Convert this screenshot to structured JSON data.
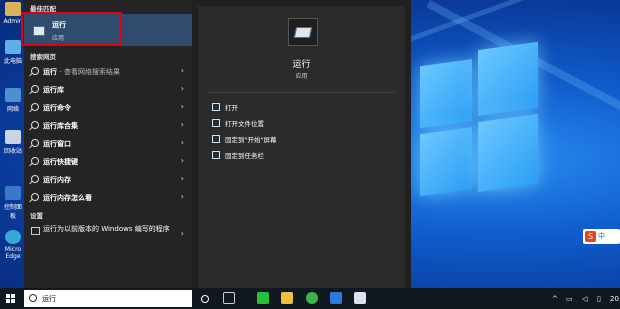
{
  "desktop": {
    "icons": [
      "Admin",
      "此电脑",
      "网络",
      "回收站",
      "控制面板",
      "Micro Edge"
    ]
  },
  "start_menu": {
    "best_match_heading": "最佳匹配",
    "best_match": {
      "title": "运行",
      "subtitle": "应用"
    },
    "web_heading": "搜索网页",
    "web_results": [
      {
        "bold": "运行",
        "rest": " - 查看网络搜索结果"
      },
      {
        "bold": "运行库",
        "rest": ""
      },
      {
        "bold": "运行命令",
        "rest": ""
      },
      {
        "bold": "运行库合集",
        "rest": ""
      },
      {
        "bold": "运行窗口",
        "rest": ""
      },
      {
        "bold": "运行快捷键",
        "rest": ""
      },
      {
        "bold": "运行内存",
        "rest": ""
      },
      {
        "bold": "运行内存怎么看",
        "rest": ""
      }
    ],
    "settings_heading": "设置",
    "settings_result": "运行为以前版本的 Windows 编写的程序",
    "detail": {
      "title": "运行",
      "subtitle": "应用",
      "actions": [
        "打开",
        "打开文件位置",
        "固定到\"开始\"屏幕",
        "固定到任务栏"
      ]
    }
  },
  "taskbar": {
    "search_value": "运行",
    "clock": "20"
  },
  "ime": {
    "lang": "中"
  }
}
